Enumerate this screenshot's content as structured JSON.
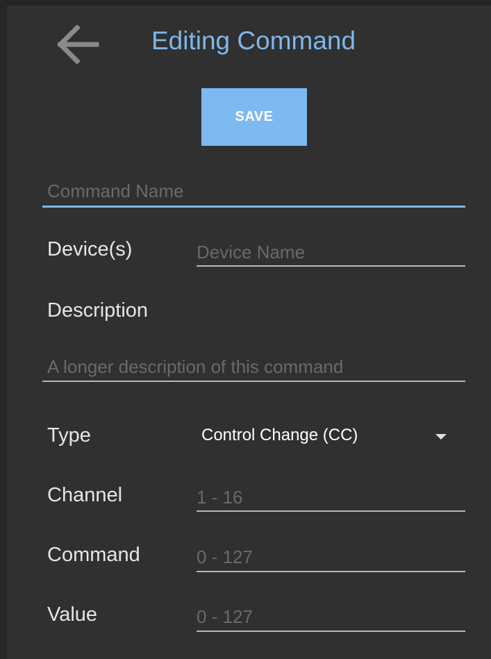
{
  "header": {
    "title": "Editing Command",
    "back_icon": "arrow-left-icon"
  },
  "toolbar": {
    "save_label": "SAVE"
  },
  "form": {
    "command_name": {
      "value": "",
      "placeholder": "Command Name"
    },
    "devices": {
      "label": "Device(s)",
      "value": "",
      "placeholder": "Device Name"
    },
    "description": {
      "label": "Description",
      "value": "",
      "placeholder": "A longer description of this command"
    },
    "type": {
      "label": "Type",
      "value": "Control Change (CC)",
      "icon": "dropdown-arrow-icon"
    },
    "channel": {
      "label": "Channel",
      "value": "",
      "placeholder": "1 - 16"
    },
    "command": {
      "label": "Command",
      "value": "",
      "placeholder": "0 - 127"
    },
    "value": {
      "label": "Value",
      "value": "",
      "placeholder": "0 - 127"
    }
  },
  "colors": {
    "accent": "#7db9f0",
    "title": "#7db7ec",
    "background": "#303030",
    "label": "#e6e6e6",
    "placeholder": "#6a6a6a",
    "underline": "#b8b8b8"
  }
}
